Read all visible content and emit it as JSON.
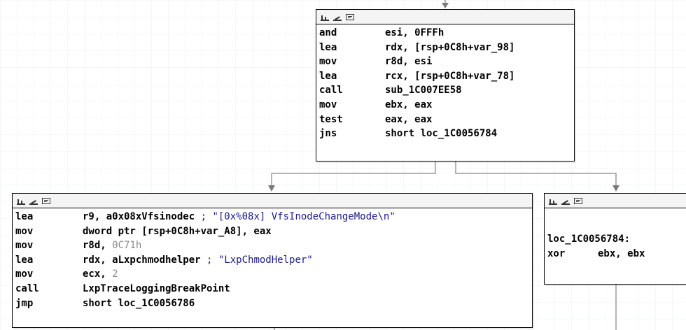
{
  "colors": {
    "edge": "#999999",
    "arrow": "#7a7a7a",
    "number": "#8a8a8a",
    "comment": "#1b1b8a"
  },
  "icons": [
    "graph-icon",
    "color-icon",
    "text-icon"
  ],
  "block_top": {
    "lines": [
      {
        "mnemonic": "and",
        "operand": "esi, 0FFFh"
      },
      {
        "mnemonic": "lea",
        "operand": "rdx, [rsp+0C8h+var_98]"
      },
      {
        "mnemonic": "mov",
        "operand": "r8d, esi"
      },
      {
        "mnemonic": "lea",
        "operand": "rcx, [rsp+0C8h+var_78]"
      },
      {
        "mnemonic": "call",
        "operand": "sub_1C007EE58"
      },
      {
        "mnemonic": "mov",
        "operand": "ebx, eax"
      },
      {
        "mnemonic": "test",
        "operand": "eax, eax"
      },
      {
        "mnemonic": "jns",
        "operand": "short loc_1C0056784"
      }
    ]
  },
  "block_left": {
    "lines": [
      {
        "mnemonic": "lea",
        "operand": "r9, a0x08xVfsinodec",
        "comment": "; \"[0x%08x] VfsInodeChangeMode\\n\""
      },
      {
        "mnemonic": "mov",
        "operand": "dword ptr [rsp+0C8h+var_A8], eax"
      },
      {
        "mnemonic": "mov",
        "operand": "r8d, ",
        "number": "0C71h"
      },
      {
        "mnemonic": "lea",
        "operand": "rdx, aLxpchmodhelper",
        "comment": "; \"LxpChmodHelper\""
      },
      {
        "mnemonic": "mov",
        "operand": "ecx, ",
        "number": "2"
      },
      {
        "mnemonic": "call",
        "operand": "LxpTraceLoggingBreakPoint"
      },
      {
        "mnemonic": "jmp",
        "operand": "short loc_1C0056786"
      }
    ]
  },
  "block_right": {
    "label": "loc_1C0056784:",
    "lines": [
      {
        "mnemonic": "xor",
        "operand": "ebx, ebx"
      }
    ]
  }
}
